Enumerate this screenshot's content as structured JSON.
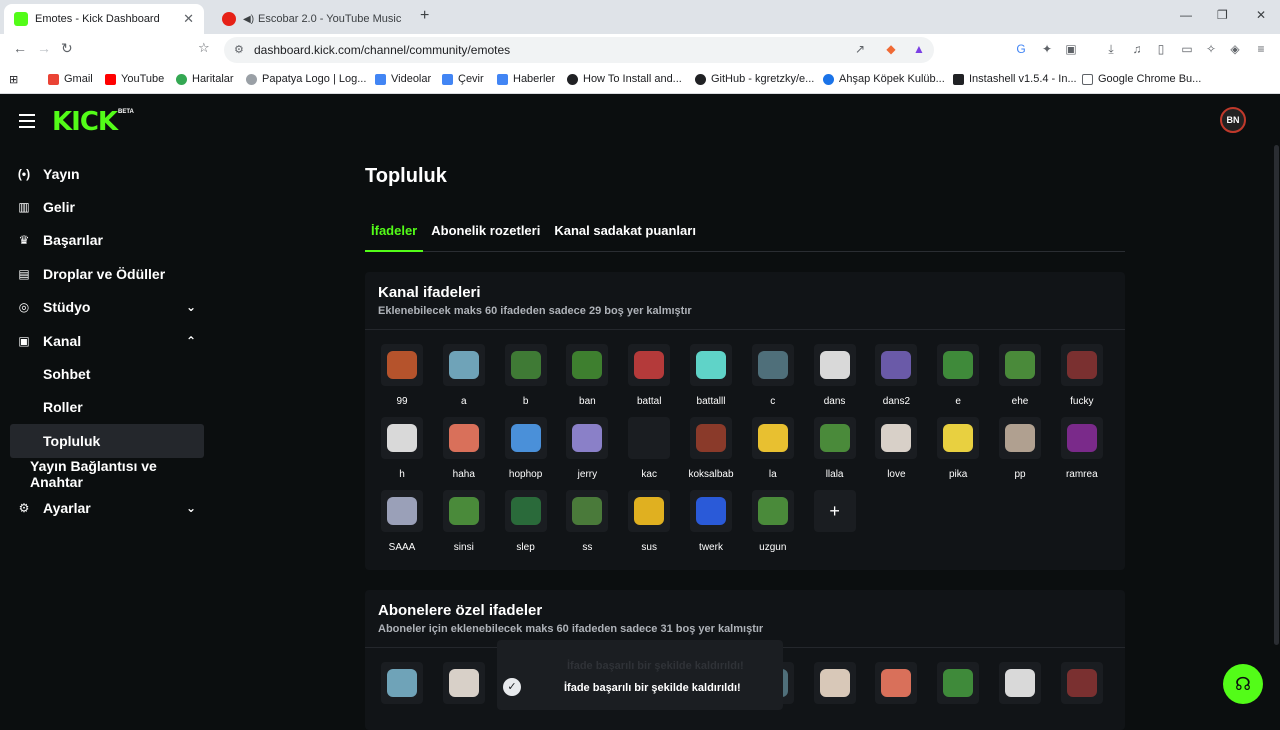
{
  "browser": {
    "tabs": [
      {
        "title": "Emotes - Kick Dashboard",
        "close": "✕"
      },
      {
        "title": "Escobar 2.0 - YouTube Music"
      }
    ],
    "new_tab": "+",
    "window_controls": [
      "—",
      "❐",
      "✕"
    ],
    "url": "dashboard.kick.com/channel/community/emotes",
    "bookmarks": [
      "Gmail",
      "YouTube",
      "Haritalar",
      "Papatya Logo | Log...",
      "Videolar",
      "Çevir",
      "Haberler",
      "How To Install and...",
      "GitHub - kgretzky/e...",
      "Ahşap Köpek Kulüb...",
      "Instashell v1.5.4 - In...",
      "Google Chrome Bu..."
    ]
  },
  "app": {
    "logo": "KICK",
    "logo_badge": "BETA",
    "avatar_initials": "BN",
    "nav": [
      {
        "label": "Yayın",
        "icon": "(•)"
      },
      {
        "label": "Gelir",
        "icon": "▥"
      },
      {
        "label": "Başarılar",
        "icon": "♛"
      },
      {
        "label": "Droplar ve Ödüller",
        "icon": "▤"
      },
      {
        "label": "Stüdyo",
        "icon": "◎",
        "chevron": "⌄"
      },
      {
        "label": "Kanal",
        "icon": "▣",
        "chevron": "⌃"
      },
      {
        "label": "Sohbet"
      },
      {
        "label": "Roller"
      },
      {
        "label": "Topluluk"
      },
      {
        "label": "Yayın Bağlantısı ve Anahtar"
      },
      {
        "label": "Ayarlar",
        "icon": "⚙",
        "chevron": "⌄"
      }
    ],
    "page_title": "Topluluk",
    "tabs": [
      "İfadeler",
      "Abonelik rozetleri",
      "Kanal sadakat puanları"
    ],
    "channel_emotes": {
      "title": "Kanal ifadeleri",
      "subtitle": "Eklenebilecek maks 60 ifadeden sadece 29 boş yer kalmıştır",
      "names": [
        "99",
        "a",
        "b",
        "ban",
        "battal",
        "battalll",
        "c",
        "dans",
        "dans2",
        "e",
        "ehe",
        "fucky",
        "h",
        "haha",
        "hophop",
        "jerry",
        "kac",
        "koksalbab",
        "la",
        "llala",
        "love",
        "pika",
        "pp",
        "ramrea",
        "SAAA",
        "sinsi",
        "slep",
        "ss",
        "sus",
        "twerk",
        "uzgun"
      ],
      "colors": [
        "#b5532c",
        "#6fa3b8",
        "#3f7a35",
        "#3e7f2f",
        "#b43a3a",
        "#5fd3c8",
        "#4f6f7a",
        "#d9d9d9",
        "#6a5aa8",
        "#3f8a3a",
        "#4a8a3a",
        "#7a3030",
        "#d9d9d9",
        "#d9705a",
        "#4a90d9",
        "#8a80c8",
        "#1a1d21",
        "#8a3a2a",
        "#e8c030",
        "#4a8a3a",
        "#d8d0c8",
        "#e8d040",
        "#b0a090",
        "#7a2a8a",
        "#9aa0b8",
        "#4a8a3a",
        "#2a6a3a",
        "#4a7a3a",
        "#e0b020",
        "#2a5ad8",
        "#4a8a3a"
      ],
      "add": "+"
    },
    "sub_emotes": {
      "title": "Abonelere özel ifadeler",
      "subtitle": "Aboneler için eklenebilecek maks 60 ifadeden sadece 31 boş yer kalmıştır",
      "colors": [
        "#6fa3b8",
        "#d8d0c8",
        "#1a1d21",
        "#1a1d21",
        "#1a1d21",
        "#1a1d21",
        "#4f6f7a",
        "#d8c8b8",
        "#d9705a",
        "#3f8a3a",
        "#d9d9d9",
        "#7a3030"
      ]
    },
    "toast": {
      "message": "İfade başarılı bir şekilde kaldırıldı!",
      "ghost": "İfade başarılı bir şekilde kaldırıldı!",
      "icon": "✓"
    },
    "help_icon": "☊"
  }
}
